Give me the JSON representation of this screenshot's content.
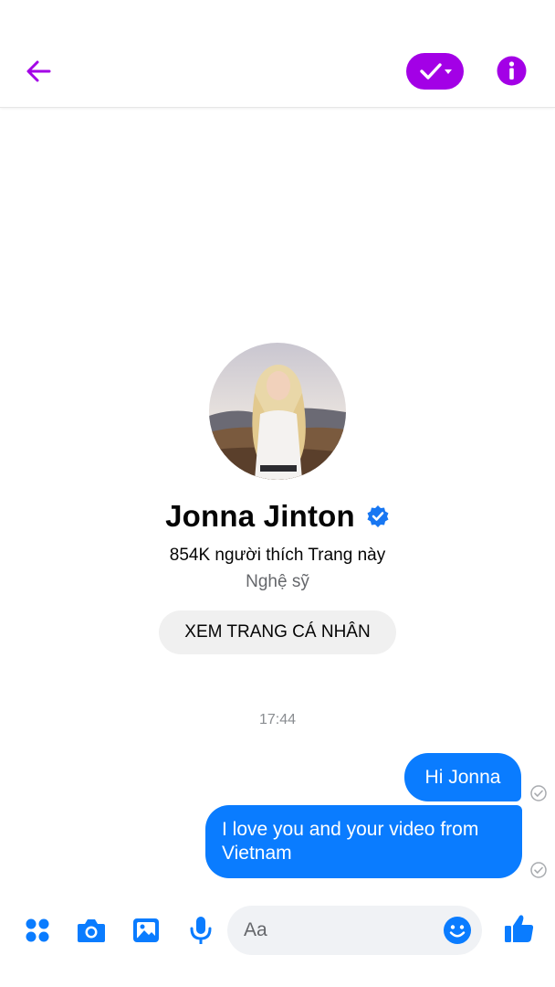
{
  "header": {
    "back_icon": "arrow-left-icon",
    "status_icon": "check-dropdown-icon",
    "info_icon": "info-icon",
    "accent_color": "#a300e6"
  },
  "profile": {
    "name": "Jonna Jinton",
    "verified_icon": "verified-badge-icon",
    "likes": "854K người thích Trang này",
    "category": "Nghệ sỹ",
    "view_button": "XEM TRANG CÁ NHÂN"
  },
  "conversation": {
    "timestamp": "17:44",
    "messages": [
      {
        "text": "Hi Jonna",
        "sender": "me",
        "status_icon": "seen-check-icon"
      },
      {
        "text": "I love you and your video from Vietnam",
        "sender": "me",
        "status_icon": "seen-check-icon"
      }
    ],
    "bubble_color": "#0a7cff"
  },
  "composer": {
    "placeholder": "Aa",
    "tools": [
      "apps-icon",
      "camera-icon",
      "gallery-icon",
      "microphone-icon"
    ],
    "emoji_icon": "emoji-icon",
    "like_icon": "thumbs-up-icon",
    "tool_color": "#0a7cff"
  }
}
